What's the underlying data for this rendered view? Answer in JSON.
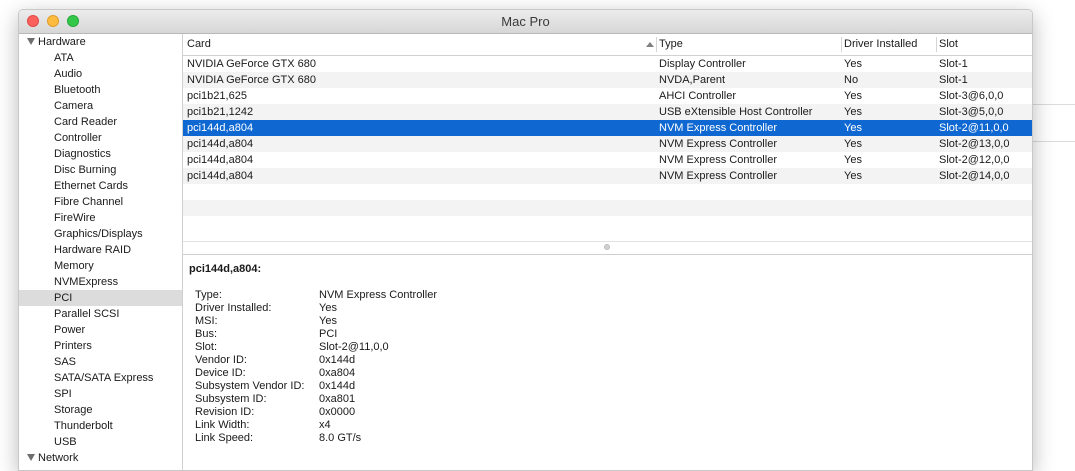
{
  "window": {
    "title": "Mac Pro"
  },
  "sidebar": {
    "group_label": "Hardware",
    "items": [
      "ATA",
      "Audio",
      "Bluetooth",
      "Camera",
      "Card Reader",
      "Controller",
      "Diagnostics",
      "Disc Burning",
      "Ethernet Cards",
      "Fibre Channel",
      "FireWire",
      "Graphics/Displays",
      "Hardware RAID",
      "Memory",
      "NVMExpress",
      "PCI",
      "Parallel SCSI",
      "Power",
      "Printers",
      "SAS",
      "SATA/SATA Express",
      "SPI",
      "Storage",
      "Thunderbolt",
      "USB"
    ],
    "selected": "PCI",
    "next_group_label": "Network"
  },
  "table": {
    "columns": [
      "Card",
      "Type",
      "Driver Installed",
      "Slot"
    ],
    "sort_column": "Card",
    "rows": [
      [
        "NVIDIA GeForce GTX 680",
        "Display Controller",
        "Yes",
        "Slot-1"
      ],
      [
        "NVIDIA GeForce GTX 680",
        "NVDA,Parent",
        "No",
        "Slot-1"
      ],
      [
        "pci1b21,625",
        "AHCI Controller",
        "Yes",
        "Slot-3@6,0,0"
      ],
      [
        "pci1b21,1242",
        "USB eXtensible Host Controller",
        "Yes",
        "Slot-3@5,0,0"
      ],
      [
        "pci144d,a804",
        "NVM Express Controller",
        "Yes",
        "Slot-2@11,0,0"
      ],
      [
        "pci144d,a804",
        "NVM Express Controller",
        "Yes",
        "Slot-2@13,0,0"
      ],
      [
        "pci144d,a804",
        "NVM Express Controller",
        "Yes",
        "Slot-2@12,0,0"
      ],
      [
        "pci144d,a804",
        "NVM Express Controller",
        "Yes",
        "Slot-2@14,0,0"
      ]
    ],
    "selected_index": 4
  },
  "detail": {
    "title": "pci144d,a804:",
    "fields": [
      {
        "key": "Type:",
        "value": "NVM Express Controller"
      },
      {
        "key": "Driver Installed:",
        "value": "Yes"
      },
      {
        "key": "MSI:",
        "value": "Yes"
      },
      {
        "key": "Bus:",
        "value": "PCI"
      },
      {
        "key": "Slot:",
        "value": "Slot-2@11,0,0"
      },
      {
        "key": "Vendor ID:",
        "value": "0x144d"
      },
      {
        "key": "Device ID:",
        "value": "0xa804"
      },
      {
        "key": "Subsystem Vendor ID:",
        "value": "0x144d"
      },
      {
        "key": "Subsystem ID:",
        "value": "0xa801"
      },
      {
        "key": "Revision ID:",
        "value": "0x0000"
      },
      {
        "key": "Link Width:",
        "value": "x4"
      },
      {
        "key": "Link Speed:",
        "value": "8.0 GT/s"
      }
    ]
  },
  "colors": {
    "selection": "#0f68d1",
    "sidebar_selection": "#dcdcdc"
  }
}
